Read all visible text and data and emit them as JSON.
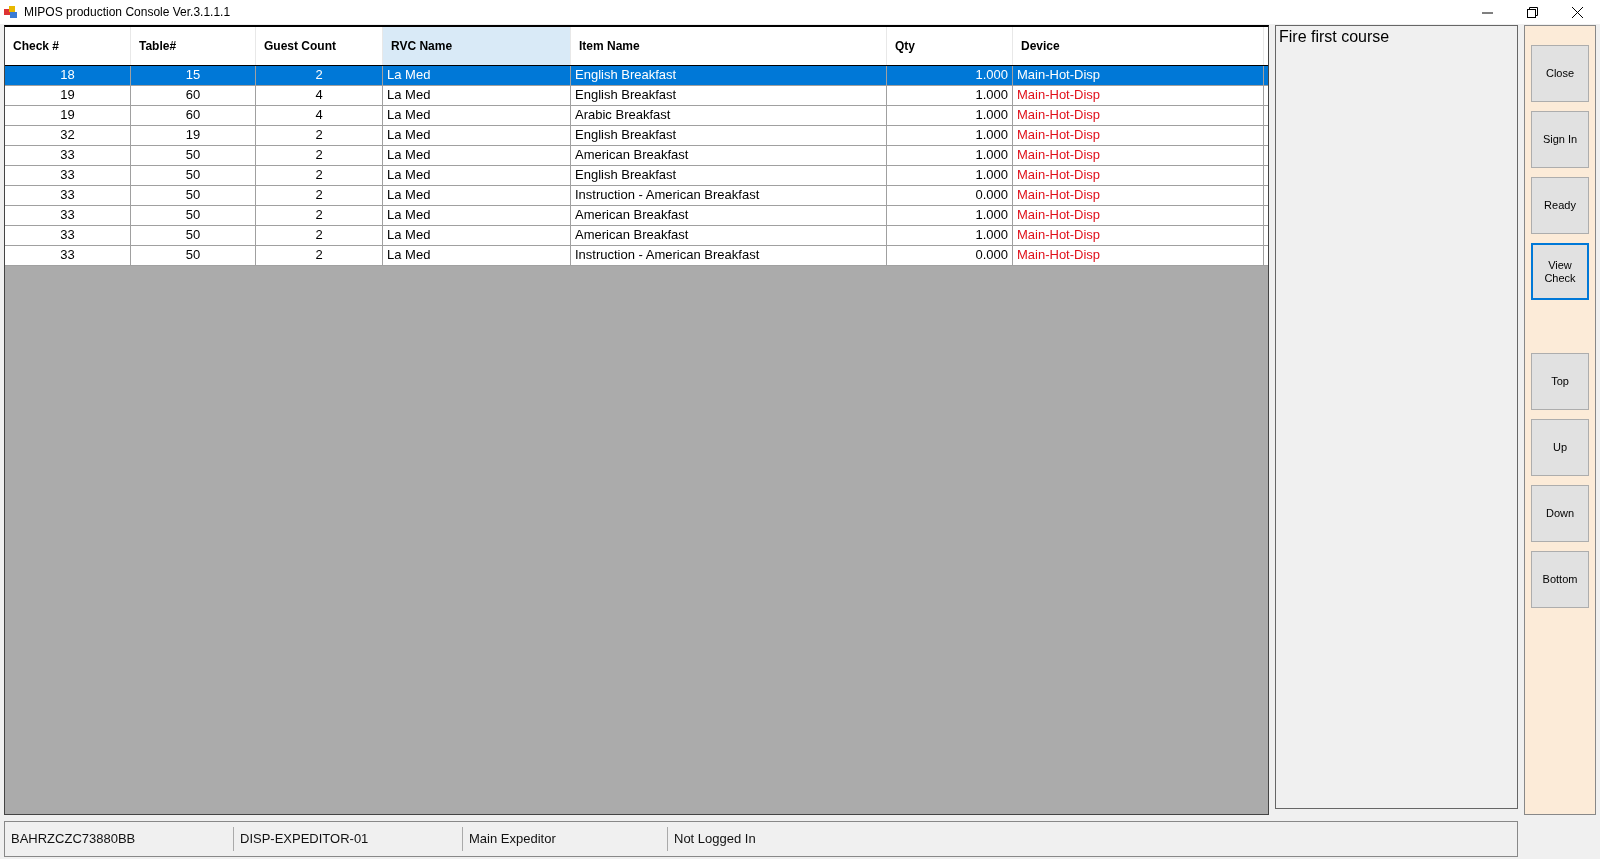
{
  "window": {
    "title": "MIPOS production Console Ver.3.1.1.1"
  },
  "table": {
    "columns": [
      {
        "label": "Check #",
        "kind": "id",
        "selected": false
      },
      {
        "label": "Table#",
        "kind": "id",
        "selected": false
      },
      {
        "label": "Guest Count",
        "kind": "id",
        "selected": false
      },
      {
        "label": "RVC Name",
        "kind": "text",
        "selected": true
      },
      {
        "label": "Item Name",
        "kind": "text",
        "selected": false
      },
      {
        "label": "Qty",
        "kind": "quantity",
        "selected": false
      },
      {
        "label": "Device",
        "kind": "device",
        "selected": false
      }
    ],
    "rows": [
      {
        "selected": true,
        "cells": [
          "18",
          "15",
          "2",
          "La Med",
          "English Breakfast",
          "1.000",
          "Main-Hot-Disp"
        ]
      },
      {
        "selected": false,
        "cells": [
          "19",
          "60",
          "4",
          "La Med",
          "English Breakfast",
          "1.000",
          "Main-Hot-Disp"
        ]
      },
      {
        "selected": false,
        "cells": [
          "19",
          "60",
          "4",
          "La Med",
          "Arabic Breakfast",
          "1.000",
          "Main-Hot-Disp"
        ]
      },
      {
        "selected": false,
        "cells": [
          "32",
          "19",
          "2",
          "La Med",
          "English Breakfast",
          "1.000",
          "Main-Hot-Disp"
        ]
      },
      {
        "selected": false,
        "cells": [
          "33",
          "50",
          "2",
          "La Med",
          "American Breakfast",
          "1.000",
          "Main-Hot-Disp"
        ]
      },
      {
        "selected": false,
        "cells": [
          "33",
          "50",
          "2",
          "La Med",
          "English Breakfast",
          "1.000",
          "Main-Hot-Disp"
        ]
      },
      {
        "selected": false,
        "cells": [
          "33",
          "50",
          "2",
          "La Med",
          "Instruction - American Breakfast",
          "0.000",
          "Main-Hot-Disp"
        ]
      },
      {
        "selected": false,
        "cells": [
          "33",
          "50",
          "2",
          "La Med",
          "American Breakfast",
          "1.000",
          "Main-Hot-Disp"
        ]
      },
      {
        "selected": false,
        "cells": [
          "33",
          "50",
          "2",
          "La Med",
          "American Breakfast",
          "1.000",
          "Main-Hot-Disp"
        ]
      },
      {
        "selected": false,
        "cells": [
          "33",
          "50",
          "2",
          "La Med",
          "Instruction - American Breakfast",
          "0.000",
          "Main-Hot-Disp"
        ]
      }
    ]
  },
  "notes": {
    "text": "Fire first course"
  },
  "action_buttons": [
    {
      "label": "Close",
      "focused": false
    },
    {
      "label": "Sign In",
      "focused": false
    },
    {
      "label": "Ready",
      "focused": false
    },
    {
      "label": "View\nCheck",
      "focused": true
    }
  ],
  "navigation_buttons": [
    {
      "label": "Top",
      "focused": false
    },
    {
      "label": "Up",
      "focused": false
    },
    {
      "label": "Down",
      "focused": false
    },
    {
      "label": "Bottom",
      "focused": false
    }
  ],
  "status_bar": [
    "BAHRZCZC73880BB",
    "DISP-EXPEDITOR-01",
    "Main Expeditor",
    "Not Logged In"
  ]
}
